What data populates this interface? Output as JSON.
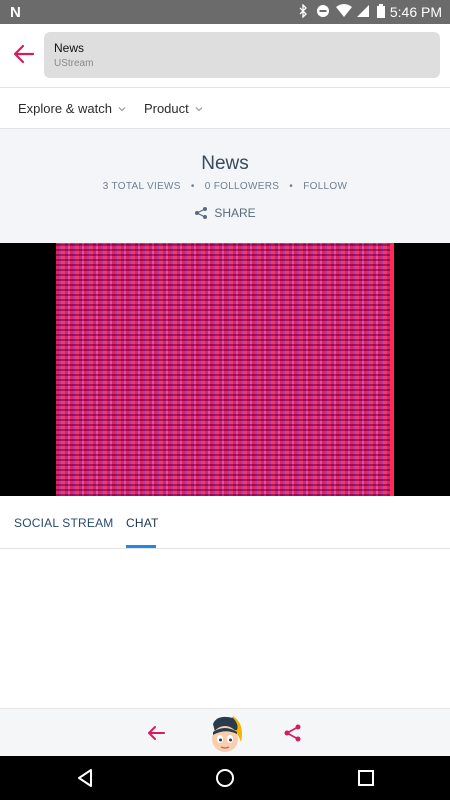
{
  "status_bar": {
    "time": "5:46 PM",
    "notification_icon": "n-logo",
    "icons": [
      "bluetooth-icon",
      "do-not-disturb-icon",
      "wifi-icon",
      "signal-icon",
      "battery-icon"
    ]
  },
  "app_bar": {
    "title": "News",
    "subtitle": "UStream",
    "back_icon": "arrow-left-icon"
  },
  "nav_menu": {
    "items": [
      {
        "label": "Explore & watch"
      },
      {
        "label": "Product"
      }
    ]
  },
  "channel": {
    "title": "News",
    "total_views": "3 TOTAL VIEWS",
    "followers": "0 FOLLOWERS",
    "follow": "FOLLOW",
    "share_label": "SHARE",
    "separator": "•"
  },
  "tabs": {
    "social_stream": "SOCIAL STREAM",
    "chat": "CHAT",
    "active": "chat"
  },
  "bottom_bar": {
    "back_icon": "arrow-left-icon",
    "avatar_icon": "mascot-avatar-icon",
    "share_icon": "share-icon"
  },
  "colors": {
    "accent": "#d81b60",
    "tab_indicator": "#1e88e5",
    "header_bg": "#f3f5f8"
  }
}
